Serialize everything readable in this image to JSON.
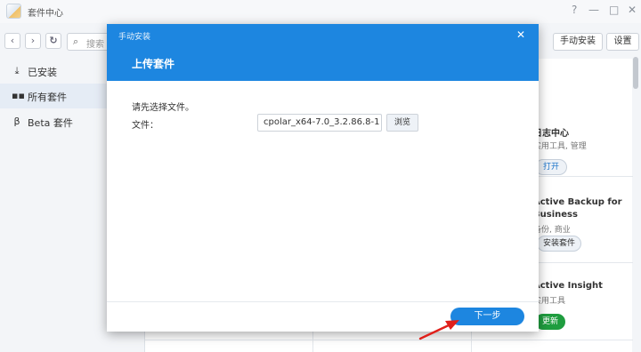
{
  "window": {
    "title": "套件中心",
    "controls": {
      "help": "?",
      "minimize": "—",
      "maximize": "□",
      "close": "✕"
    }
  },
  "toolbar": {
    "back_icon": "chevron-left-icon",
    "forward_icon": "chevron-right-icon",
    "refresh_icon": "refresh-icon",
    "search_placeholder": "搜索",
    "manual_install_label": "手动安装",
    "settings_label": "设置"
  },
  "sidebar": {
    "items": [
      {
        "label": "已安装",
        "icon": "download-icon"
      },
      {
        "label": "所有套件",
        "icon": "grid-icon",
        "active": true
      },
      {
        "label": "Beta 套件",
        "icon": "beta-icon"
      }
    ]
  },
  "packages": [
    {
      "title": "日志中心",
      "subtitle": "实用工具, 管理",
      "action": "打开"
    },
    {
      "title": "Active Backup for",
      "title2": "Business",
      "subtitle": "备份, 商业",
      "action": "安装套件"
    },
    {
      "title": "Active Insight",
      "subtitle": "实用工具",
      "action": "更新"
    }
  ],
  "modal": {
    "app_name": "手动安装",
    "close": "✕",
    "title": "上传套件",
    "prompt": "请先选择文件。",
    "file_label": "文件：",
    "file_value": "cpolar_x64-7.0_3.2.86.8-1",
    "browse_label": "浏览",
    "next_label": "下一步"
  },
  "colors": {
    "accent": "#1d86e0",
    "update_green": "#1f9d3f",
    "annotation_arrow": "#e0201b"
  }
}
